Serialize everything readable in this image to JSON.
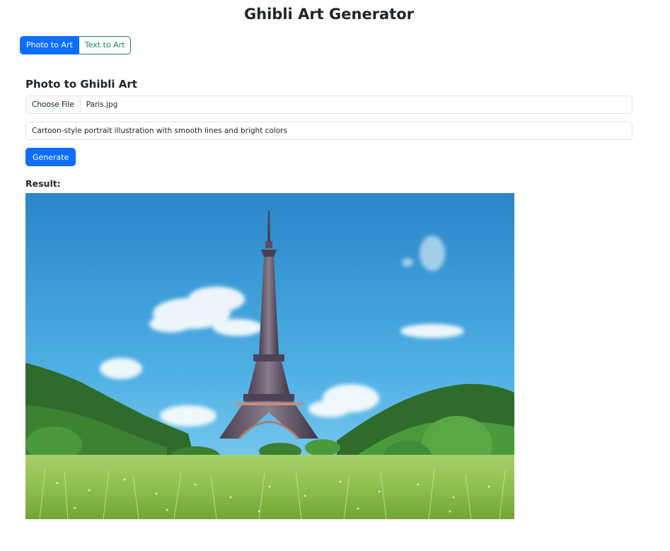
{
  "app": {
    "title": "Ghibli Art Generator"
  },
  "mode_tabs": [
    {
      "label": "Photo to Art",
      "active": true
    },
    {
      "label": "Text to Art",
      "active": false
    }
  ],
  "photo_form": {
    "heading": "Photo to Ghibli Art",
    "file_button_label": "Choose File",
    "file_name": "Paris.jpg",
    "prompt_value": "Cartoon-style portrait illustration with smooth lines and bright colors",
    "generate_label": "Generate"
  },
  "result": {
    "label": "Result:",
    "image_subject": "eiffel-tower-ghibli-landscape"
  },
  "colors": {
    "primary": "#0d6efd",
    "success": "#198754",
    "text": "#212529",
    "border": "#dee2e6"
  }
}
